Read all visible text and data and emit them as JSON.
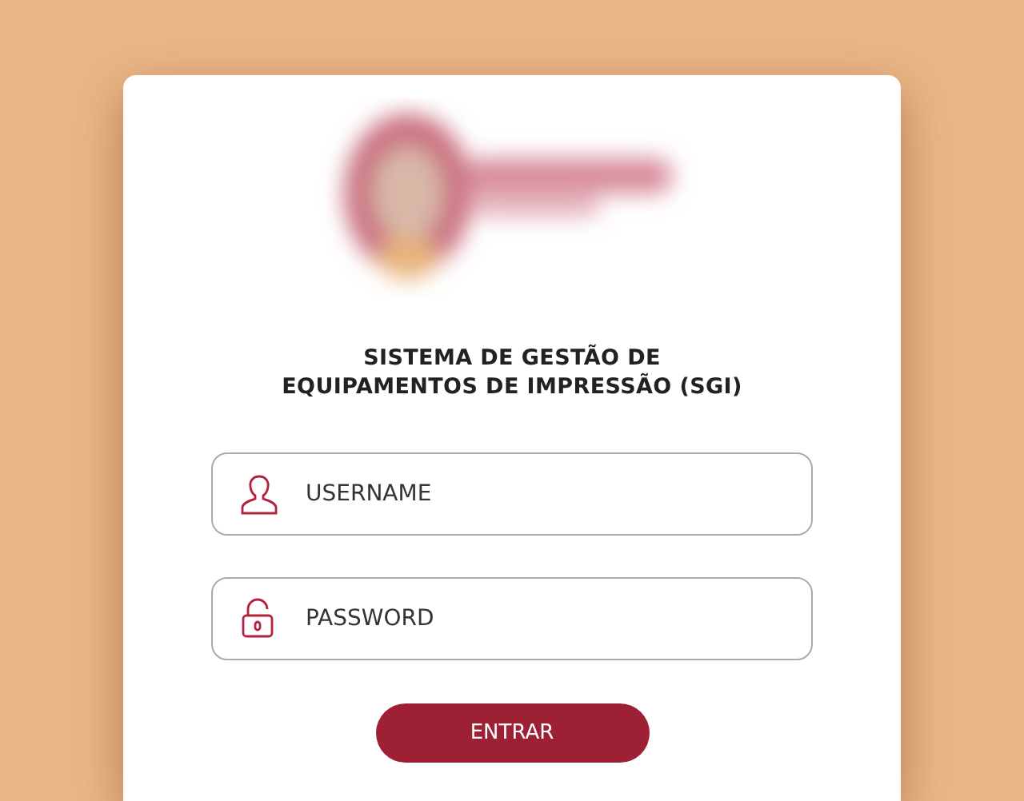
{
  "title_lines": [
    "SISTEMA DE GESTÃO DE",
    "EQUIPAMENTOS DE IMPRESSÃO (SGI)"
  ],
  "fields": [
    {
      "kind": "user",
      "placeholder": "USERNAME"
    },
    {
      "kind": "lock",
      "placeholder": "PASSWORD"
    }
  ],
  "button": "ENTRAR"
}
